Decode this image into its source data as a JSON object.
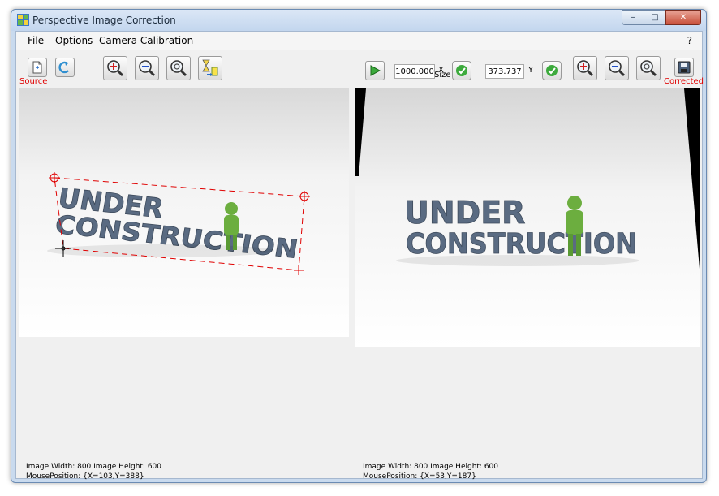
{
  "window": {
    "title": "Perspective Image Correction"
  },
  "caption": {
    "minimize": "–",
    "maximize": "□",
    "close": "✕"
  },
  "menu": {
    "file": "File",
    "options": "Options",
    "camera": "Camera Calibration",
    "help": "?"
  },
  "toolbar": {
    "source_label": "Source",
    "corrected_label": "Corrected",
    "real_rect_label": "Real Rect Size",
    "x_value": "1000.000",
    "x_axis": "X",
    "y_value": "373.737",
    "y_axis": "Y"
  },
  "image_text": {
    "line1": "UNDER",
    "line2": "CONSTRUCTION"
  },
  "left_status": {
    "size": "Image Width: 800 Image Height: 600",
    "mouse": "MousePosition: {X=103,Y=388}"
  },
  "right_status": {
    "size": "Image Width: 800 Image Height: 600",
    "mouse": "MousePosition: {X=53,Y=187}"
  },
  "colors": {
    "marker": "#e00000",
    "letters": "#5a6b82",
    "figure": "#6cae3f",
    "accent_red": "#e00000"
  },
  "icons": [
    "app-icon",
    "new-document-icon",
    "rotate-icon",
    "zoom-in-icon",
    "zoom-out-icon",
    "zoom-fit-icon",
    "transform-icon",
    "play-icon",
    "check-icon",
    "save-icon"
  ]
}
